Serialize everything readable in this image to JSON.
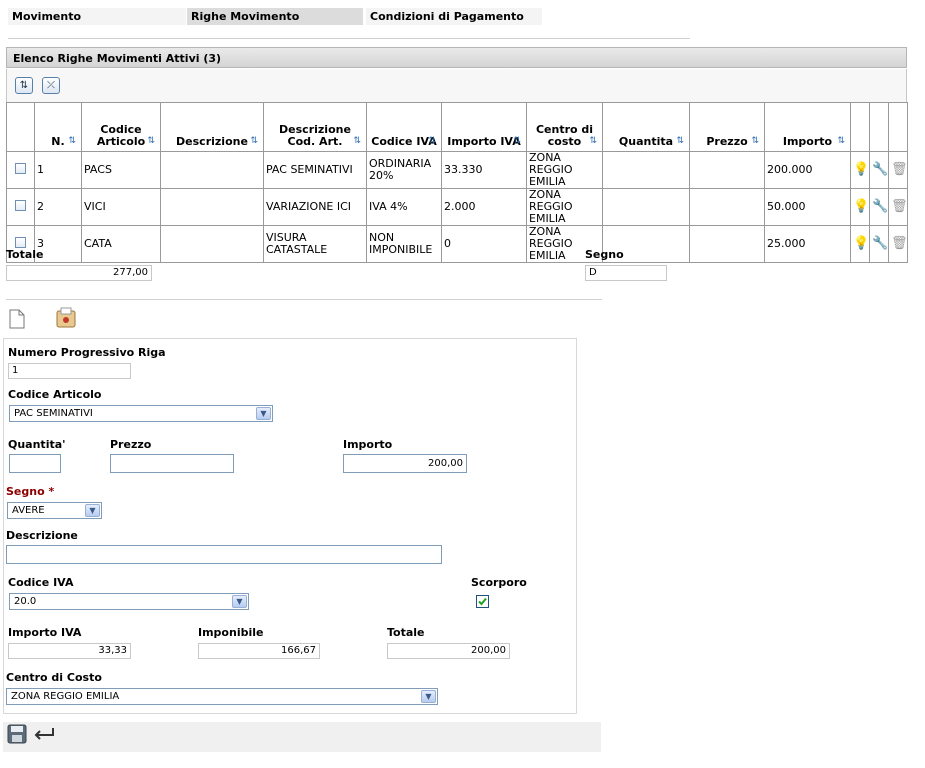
{
  "tabs": [
    "Movimento",
    "Righe Movimento",
    "Condizioni di Pagamento"
  ],
  "panel_title": "Elenco Righe Movimenti Attivi (3)",
  "toolbar": {
    "sort_icon": "sort-arrows-icon",
    "clear_sort_icon": "clear-sort-icon"
  },
  "columns": [
    {
      "label": "N."
    },
    {
      "label": "Codice Articolo"
    },
    {
      "label": "Descrizione"
    },
    {
      "label": "Descrizione Cod. Art."
    },
    {
      "label": "Codice IVA"
    },
    {
      "label": "Importo IVA"
    },
    {
      "label": "Centro di costo"
    },
    {
      "label": "Quantita"
    },
    {
      "label": "Prezzo"
    },
    {
      "label": "Importo"
    }
  ],
  "rows": [
    {
      "n": "1",
      "codice": "PACS",
      "descrizione": "",
      "desc_cod": "PAC SEMINATIVI",
      "iva": "ORDINARIA 20%",
      "importo_iva": "33.330",
      "centro": "ZONA REGGIO EMILIA",
      "quantita": "",
      "prezzo": "",
      "importo": "200.000"
    },
    {
      "n": "2",
      "codice": "VICI",
      "descrizione": "",
      "desc_cod": "VARIAZIONE ICI",
      "iva": "IVA 4%",
      "importo_iva": "2.000",
      "centro": "ZONA REGGIO EMILIA",
      "quantita": "",
      "prezzo": "",
      "importo": "50.000"
    },
    {
      "n": "3",
      "codice": "CATA",
      "descrizione": "",
      "desc_cod": "VISURA CATASTALE",
      "iva": "NON IMPONIBILE",
      "importo_iva": "0",
      "centro": "ZONA REGGIO EMILIA",
      "quantita": "",
      "prezzo": "",
      "importo": "25.000"
    }
  ],
  "summary": {
    "totale_label": "Totale",
    "totale_value": "277,00",
    "segno_label": "Segno",
    "segno_value": "D"
  },
  "form": {
    "numero_label": "Numero Progressivo Riga",
    "numero_value": "1",
    "codice_articolo_label": "Codice Articolo",
    "codice_articolo_value": "PAC SEMINATIVI",
    "quantita_label": "Quantita'",
    "quantita_value": "",
    "prezzo_label": "Prezzo",
    "prezzo_value": "",
    "importo_label": "Importo",
    "importo_value": "200,00",
    "segno_label": "Segno",
    "segno_required": "*",
    "segno_value": "AVERE",
    "descrizione_label": "Descrizione",
    "descrizione_value": "",
    "codice_iva_label": "Codice IVA",
    "codice_iva_value": "20.0",
    "scorporo_label": "Scorporo",
    "scorporo_checked": true,
    "importo_iva_label": "Importo IVA",
    "importo_iva_value": "33,33",
    "imponibile_label": "Imponibile",
    "imponibile_value": "166,67",
    "totale_label": "Totale",
    "totale_value": "200,00",
    "centro_label": "Centro di Costo",
    "centro_value": "ZONA REGGIO EMILIA"
  },
  "colors": {
    "required": "#8b0000",
    "input_border": "#7f9db9",
    "header_bg": "#dcdcdc"
  }
}
